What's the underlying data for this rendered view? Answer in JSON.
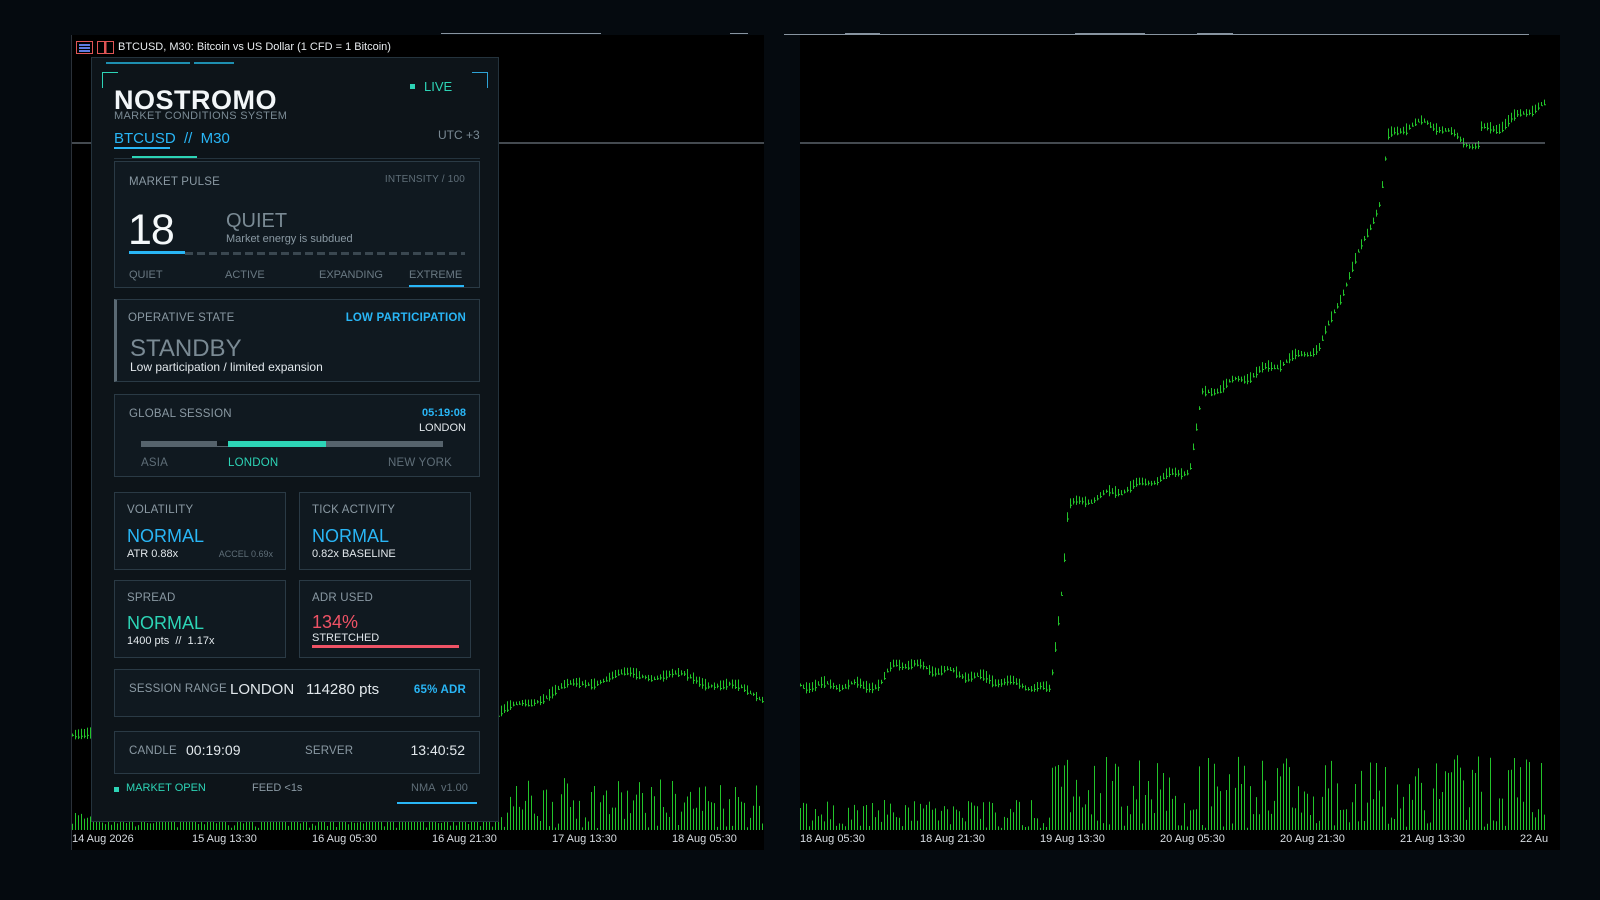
{
  "chart_left": {
    "title": "BTCUSD, M30:  Bitcoin vs US Dollar (1 CFD = 1 Bitcoin)",
    "xticks": [
      "14 Aug 2026",
      "15 Aug 13:30",
      "16 Aug 05:30",
      "16 Aug 21:30",
      "17 Aug 13:30",
      "18 Aug 05:30"
    ]
  },
  "chart_right": {
    "xticks": [
      "18 Aug 05:30",
      "18 Aug 21:30",
      "19 Aug 13:30",
      "20 Aug 05:30",
      "20 Aug 21:30",
      "21 Aug 13:30",
      "22 Au"
    ]
  },
  "colors": {
    "candle": "#22c42a",
    "teal": "#2dd4b6",
    "blue": "#29b6f6",
    "red": "#ef5366",
    "panel_bg": "#0d1419"
  },
  "panel": {
    "brand": "NOSTROMO",
    "subtitle": "MARKET CONDITIONS SYSTEM",
    "live": "LIVE",
    "symbol": "BTCUSD  //  M30",
    "utc": "UTC +3",
    "pulse": {
      "label": "MARKET PULSE",
      "intensity_label": "INTENSITY / 100",
      "value": "18",
      "state": "QUIET",
      "description": "Market energy is subdued",
      "scale": [
        "QUIET",
        "ACTIVE",
        "EXPANDING",
        "EXTREME"
      ]
    },
    "operative": {
      "label": "OPERATIVE STATE",
      "tag": "LOW PARTICIPATION",
      "state": "STANDBY",
      "description": "Low participation / limited expansion"
    },
    "session": {
      "label": "GLOBAL SESSION",
      "time": "05:19:08",
      "current": "LONDON",
      "sessions": [
        "ASIA",
        "LONDON",
        "NEW YORK"
      ]
    },
    "volatility": {
      "label": "VOLATILITY",
      "state": "NORMAL",
      "detail": "ATR 0.88x",
      "extra": "ACCEL 0.69x"
    },
    "tick_activity": {
      "label": "TICK ACTIVITY",
      "state": "NORMAL",
      "detail": "0.82x BASELINE"
    },
    "spread": {
      "label": "SPREAD",
      "state": "NORMAL",
      "detail": "1400 pts  //  1.17x"
    },
    "adr": {
      "label": "ADR USED",
      "value": "134%",
      "detail": "STRETCHED",
      "fill": 1.0
    },
    "range": {
      "label": "SESSION RANGE",
      "session": "LONDON",
      "points": "114280 pts",
      "adr": "65% ADR"
    },
    "clock": {
      "candle_label": "CANDLE",
      "candle_value": "00:19:09",
      "server_label": "SERVER",
      "server_value": "13:40:52"
    },
    "footer": {
      "status": "MARKET OPEN",
      "feed": "FEED <1s",
      "version": "NMA  v1.00"
    }
  }
}
